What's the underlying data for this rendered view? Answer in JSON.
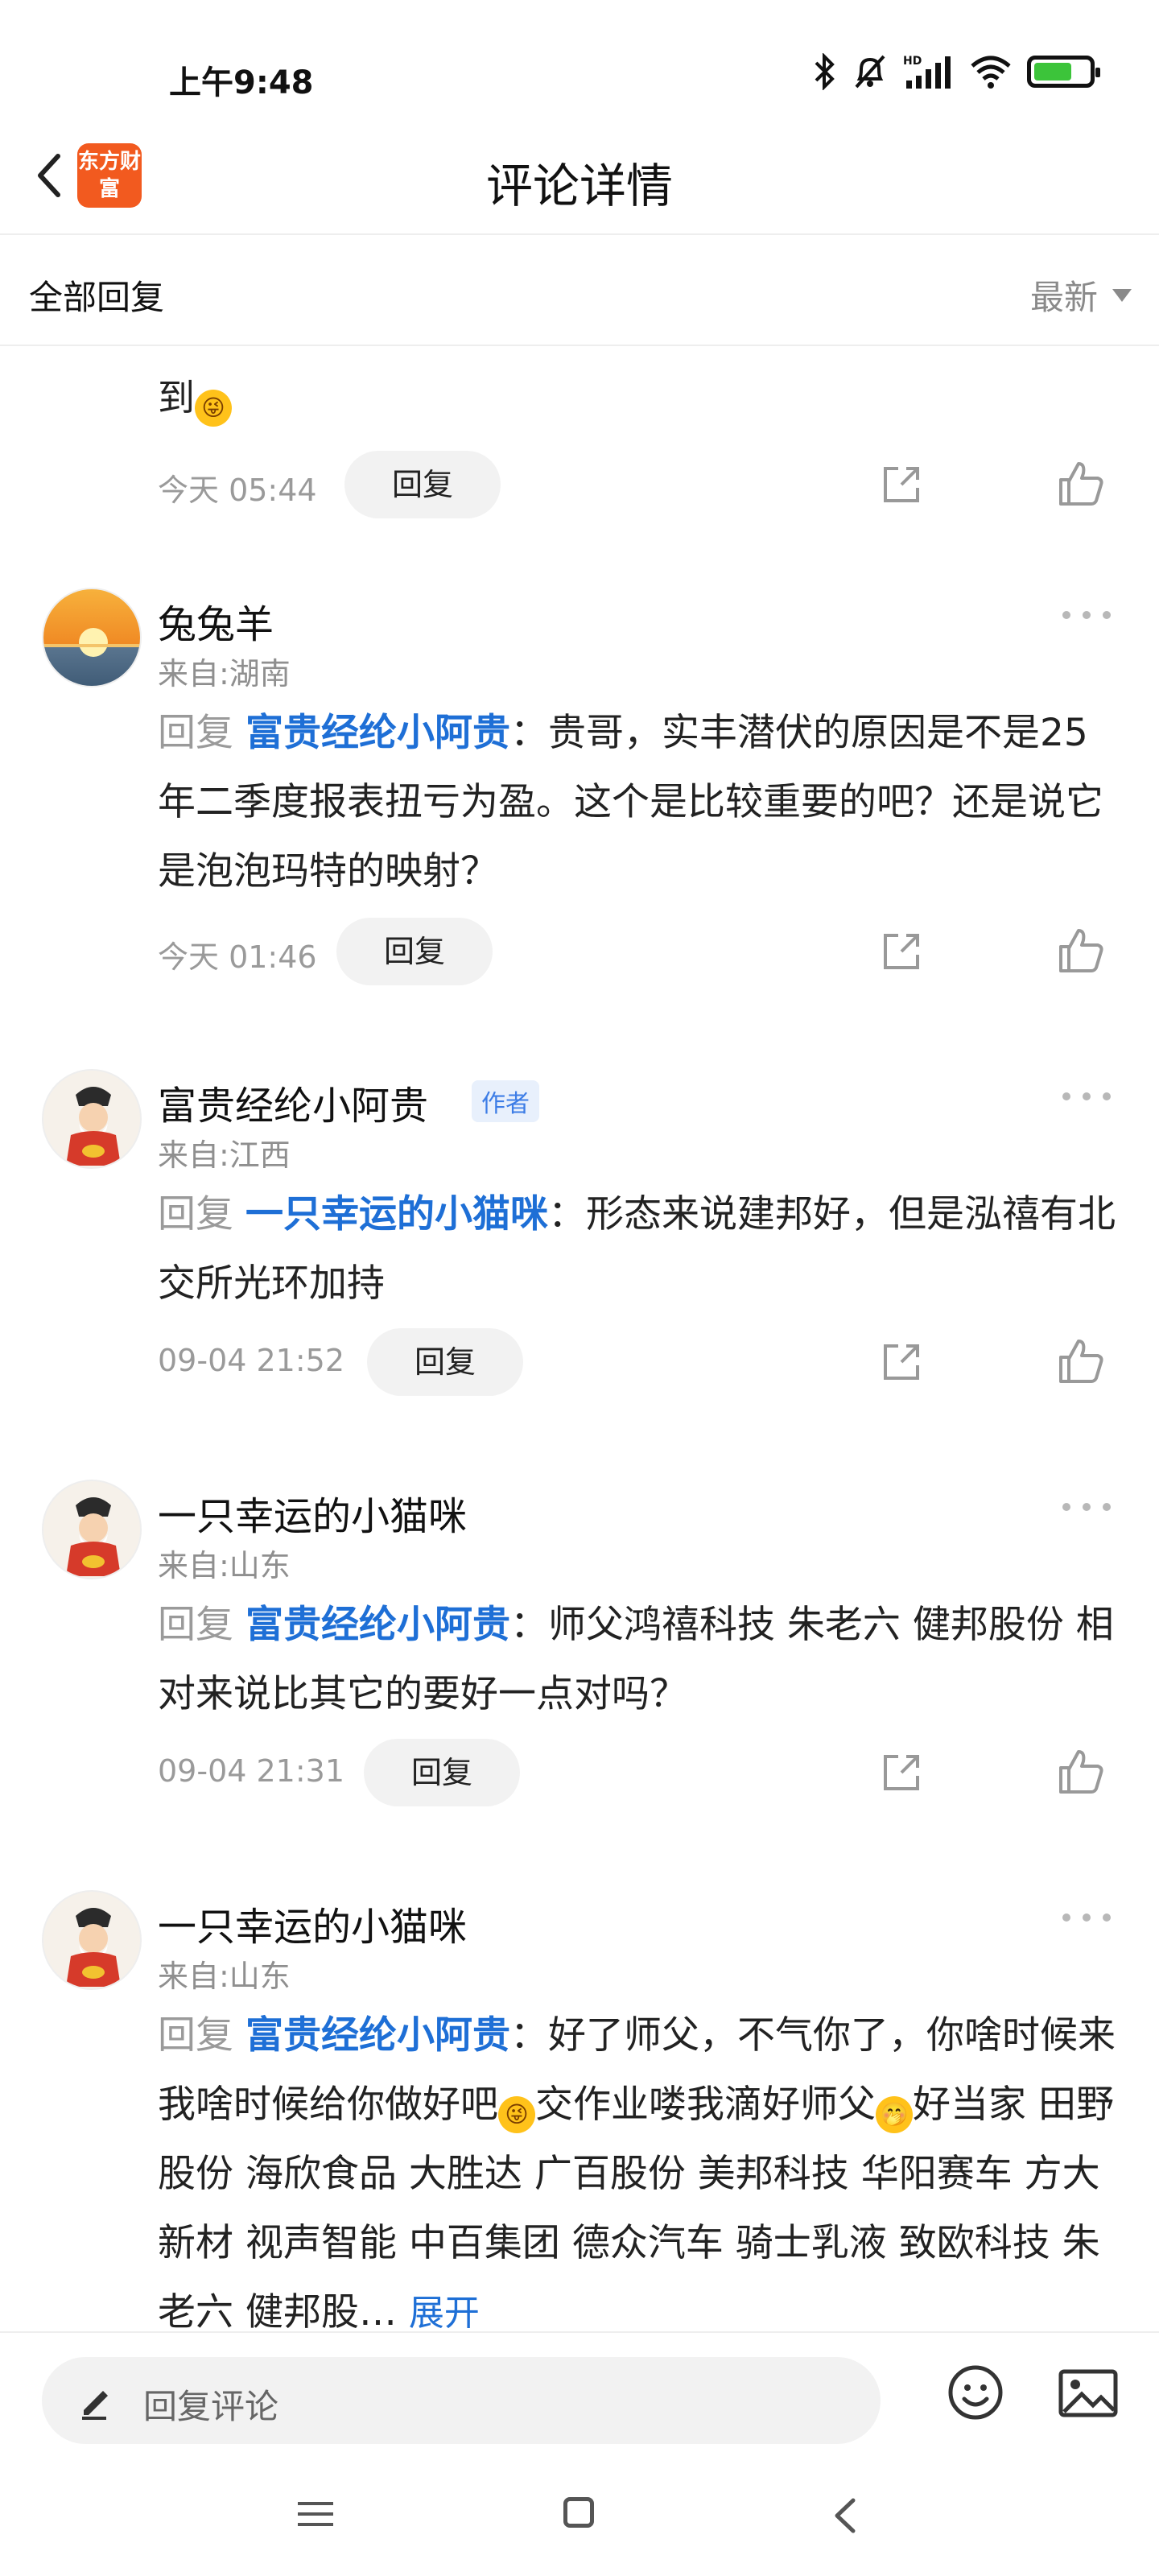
{
  "status_bar": {
    "time": "上午9:48",
    "icons": [
      "bluetooth-icon",
      "mute-bell-icon",
      "hd-signal-icon",
      "wifi-icon",
      "battery-charging-icon"
    ],
    "battery_level": 0.7
  },
  "header": {
    "title": "评论详情",
    "logo_text": "东方财富",
    "back_icon": "chevron-left-icon"
  },
  "filter_bar": {
    "left_label": "全部回复",
    "sort_label": "最新"
  },
  "prev_comment": {
    "text_tail": "到",
    "timestamp": "今天 05:44",
    "reply_label": "回复"
  },
  "comments": [
    {
      "user": "兔兔羊",
      "is_author": false,
      "location": "来自:湖南",
      "reply_prefix": "回复",
      "reply_target": "富贵经纶小阿贵",
      "text": "：贵哥，实丰潜伏的原因是不是25年二季度报表扭亏为盈。这个是比较重要的吧？还是说它是泡泡玛特的映射？",
      "timestamp": "今天 01:46",
      "reply_label": "回复"
    },
    {
      "user": "富贵经纶小阿贵",
      "is_author": true,
      "author_label": "作者",
      "location": "来自:江西",
      "reply_prefix": "回复",
      "reply_target": "一只幸运的小猫咪",
      "text": "：形态来说建邦好，但是泓禧有北交所光环加持",
      "timestamp": "09-04 21:52",
      "reply_label": "回复"
    },
    {
      "user": "一只幸运的小猫咪",
      "is_author": false,
      "location": "来自:山东",
      "reply_prefix": "回复",
      "reply_target": "富贵经纶小阿贵",
      "text": "：师父鸿禧科技 朱老六 健邦股份 相对来说比其它的要好一点对吗？",
      "timestamp": "09-04 21:31",
      "reply_label": "回复"
    },
    {
      "user": "一只幸运的小猫咪",
      "is_author": false,
      "location": "来自:山东",
      "reply_prefix": "回复",
      "reply_target": "富贵经纶小阿贵",
      "text_part1": "：好了师父，不气你了，你啥时候来我啥时候给你做好吧",
      "text_part2": "交作业喽我滴好师父",
      "text_part3": "好当家 田野股份 海欣食品 大胜达 广百股份 美邦科技 华阳赛车 方大新材 视声智能 中百集团 德众汽车 骑士乳液 致欧科技 朱老六 健邦股",
      "expand_label": "展开"
    }
  ],
  "composer": {
    "placeholder": "回复评论",
    "icons": [
      "pen-icon",
      "emoji-icon",
      "image-icon"
    ]
  },
  "nav_bar": {
    "icons": [
      "menu-icon",
      "home-square-icon",
      "back-triangle-icon"
    ]
  }
}
